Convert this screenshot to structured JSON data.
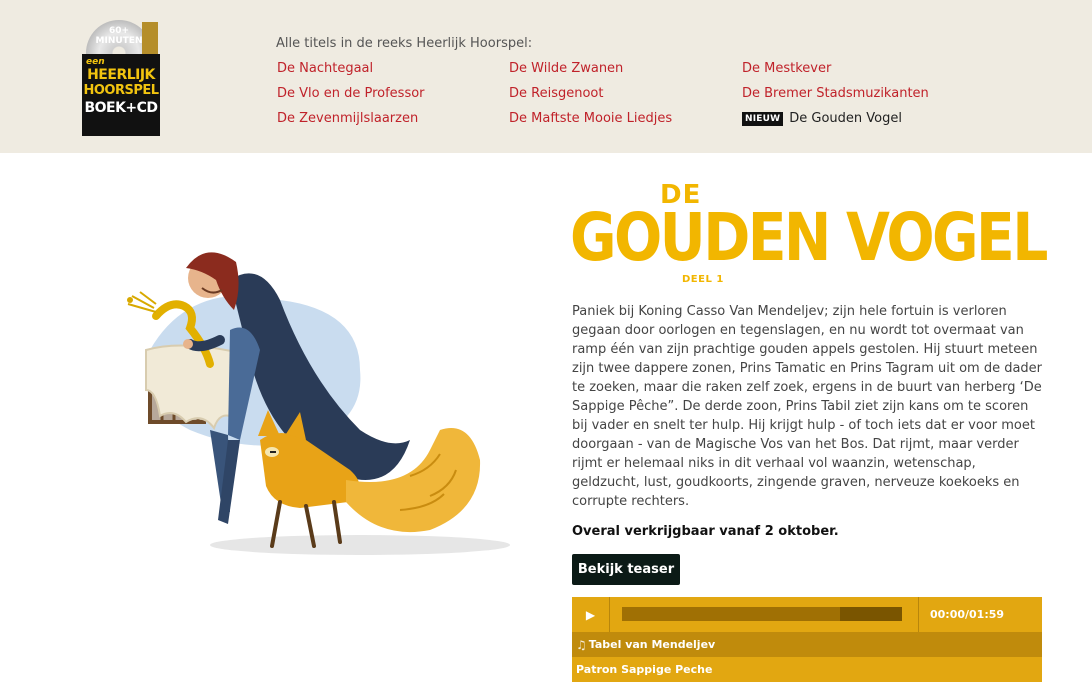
{
  "logo": {
    "disc_line1": "60+",
    "disc_line2": "MINUTEN",
    "een": "een",
    "line1": "HEERLIJK",
    "line2": "HOORSPEL",
    "line3": "BOEK+CD"
  },
  "series": {
    "heading": "Alle titels in de reeks Heerlijk Hoorspel:",
    "titles": [
      "De Nachtegaal",
      "De Wilde Zwanen",
      "De Mestkever",
      "De Vlo en de Professor",
      "De Reisgenoot",
      "De Bremer Stadsmuzikanten",
      "De Zevenmijlslaarzen",
      "De Maftste Mooie Liedjes"
    ],
    "new_badge": "NIEUW",
    "new_title": "De Gouden Vogel"
  },
  "hero": {
    "title_de": "DE",
    "title_main": "GOUDEN VOGEL",
    "title_deel": "DEEL 1",
    "description": "Paniek bij Koning Casso Van Mendeljev; zijn hele fortuin is verloren gegaan door oorlogen en tegenslagen, en nu wordt tot overmaat van ramp één van zijn prachtige gouden appels gestolen. Hij stuurt meteen zijn twee dappere zonen, Prins Tamatic en Prins Tagram uit om de dader te zoeken, maar die raken zelf zoek, ergens in de buurt van herberg ‘De Sappige Pêche”. De derde zoon, Prins Tabil ziet zijn kans om te scoren bij vader en snelt ter hulp. Hij krijgt hulp - of toch iets dat er voor moet doorgaan - van de Magische Vos van het Bos. Dat rijmt, maar verder rijmt er helemaal niks in dit verhaal vol waanzin, wetenschap, geldzucht, lust, goudkoorts, zingende graven, nerveuze koekoeks en corrupte rechters.",
    "available": "Overal verkrijgbaar vanaf 2 oktober.",
    "teaser_button": "Bekijk teaser"
  },
  "player": {
    "play_icon": "play-icon",
    "time": "00:00/01:59",
    "progress_loaded": 0.78,
    "playlist": [
      {
        "title": "Tabel van Mendeljev",
        "active": true
      },
      {
        "title": "Patron Sappige Peche",
        "active": false
      }
    ]
  },
  "colors": {
    "header_bg": "#efebe1",
    "link_red": "#c0222a",
    "gold": "#f2b600",
    "player_gold": "#e2a711",
    "button_dark": "#0b1a16"
  }
}
